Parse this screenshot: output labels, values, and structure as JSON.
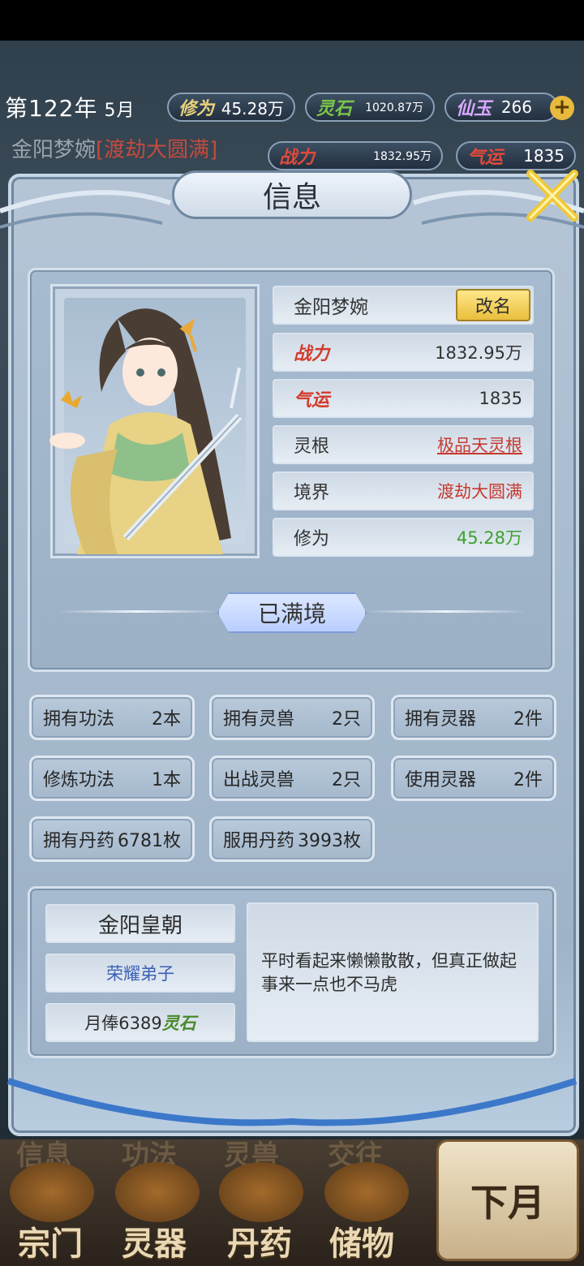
{
  "hud": {
    "year": "第122年",
    "month": "5月",
    "xiuwei_label": "修为",
    "xiuwei_value": "45.28万",
    "lingshi_label": "灵石",
    "lingshi_value": "1020.87万",
    "xianyu_label": "仙玉",
    "xianyu_value": "266",
    "plus": "+",
    "name": "金阳梦婉",
    "rank": "[渡劫大圆满]",
    "zhanli_label": "战力",
    "zhanli_value": "1832.95万",
    "qiyun_label": "气运",
    "qiyun_value": "1835"
  },
  "panel": {
    "title": "信息",
    "rename": "改名",
    "maxed": "已满境"
  },
  "info": {
    "name": "金阳梦婉",
    "zhanli_label": "战力",
    "zhanli_value": "1832.95万",
    "qiyun_label": "气运",
    "qiyun_value": "1835",
    "linggen_label": "灵根",
    "linggen_value": "极品天灵根",
    "jingjie_label": "境界",
    "jingjie_value": "渡劫大圆满",
    "xiuwei_label": "修为",
    "xiuwei_value": "45.28万"
  },
  "stats": [
    {
      "label": "拥有功法",
      "value": "2本"
    },
    {
      "label": "拥有灵兽",
      "value": "2只"
    },
    {
      "label": "拥有灵器",
      "value": "2件"
    },
    {
      "label": "修炼功法",
      "value": "1本"
    },
    {
      "label": "出战灵兽",
      "value": "2只"
    },
    {
      "label": "使用灵器",
      "value": "2件"
    },
    {
      "label": "拥有丹药",
      "value": "6781枚"
    },
    {
      "label": "服用丹药",
      "value": "3993枚"
    }
  ],
  "sect": {
    "name": "金阳皇朝",
    "title": "荣耀弟子",
    "salary_prefix": "月俸6389",
    "salary_unit": "灵石",
    "description": "平时看起来懒懒散散，但真正做起事来一点也不马虎"
  },
  "nav": {
    "ghost_tabs": [
      "信息",
      "功法",
      "灵兽",
      "交往"
    ],
    "tabs": [
      "宗门",
      "灵器",
      "丹药",
      "储物"
    ],
    "next_month": "下月"
  },
  "colors": {
    "accent_gold": "#e9bf3c",
    "rank_red": "#c63a30",
    "xiuwei_green": "#3ca12f",
    "sect_title_blue": "#3b5fb4"
  }
}
